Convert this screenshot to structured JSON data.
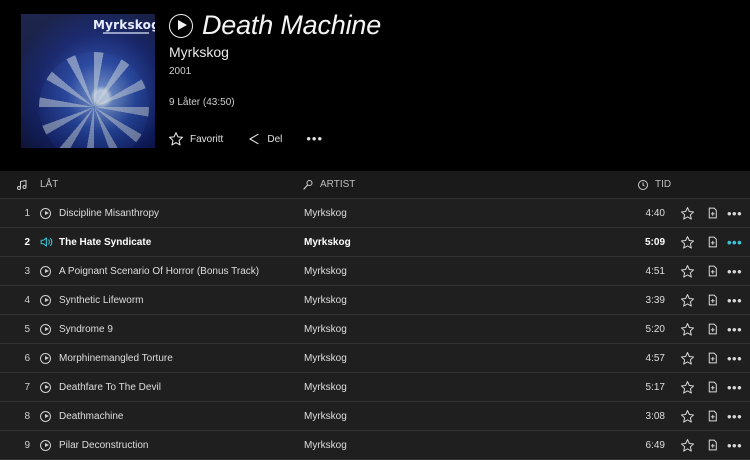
{
  "album": {
    "cover_logo": "Myrkskog",
    "title": "Death Machine",
    "artist": "Myrkskog",
    "year": "2001",
    "track_count": "9 Låter (43:50)",
    "favorite_label": "Favoritt",
    "share_label": "Del",
    "more_label": "•••"
  },
  "table": {
    "col_track": "LÅT",
    "col_artist": "ARTIST",
    "col_time": "TID",
    "more_label": "•••"
  },
  "tracks": [
    {
      "num": "1",
      "title": "Discipline Misanthropy",
      "artist": "Myrkskog",
      "time": "4:40"
    },
    {
      "num": "2",
      "title": "The Hate Syndicate",
      "artist": "Myrkskog",
      "time": "5:09"
    },
    {
      "num": "3",
      "title": "A Poignant Scenario Of Horror (Bonus Track)",
      "artist": "Myrkskog",
      "time": "4:51"
    },
    {
      "num": "4",
      "title": "Synthetic Lifeworm",
      "artist": "Myrkskog",
      "time": "3:39"
    },
    {
      "num": "5",
      "title": "Syndrome 9",
      "artist": "Myrkskog",
      "time": "5:20"
    },
    {
      "num": "6",
      "title": "Morphinemangled Torture",
      "artist": "Myrkskog",
      "time": "4:57"
    },
    {
      "num": "7",
      "title": "Deathfare To The Devil",
      "artist": "Myrkskog",
      "time": "5:17"
    },
    {
      "num": "8",
      "title": "Deathmachine",
      "artist": "Myrkskog",
      "time": "3:08"
    },
    {
      "num": "9",
      "title": "Pilar Deconstruction",
      "artist": "Myrkskog",
      "time": "6:49"
    }
  ],
  "active_track_index": 1,
  "colors": {
    "accent": "#38c6d9",
    "background": "#000000",
    "list_background": "#1f1f1f"
  }
}
